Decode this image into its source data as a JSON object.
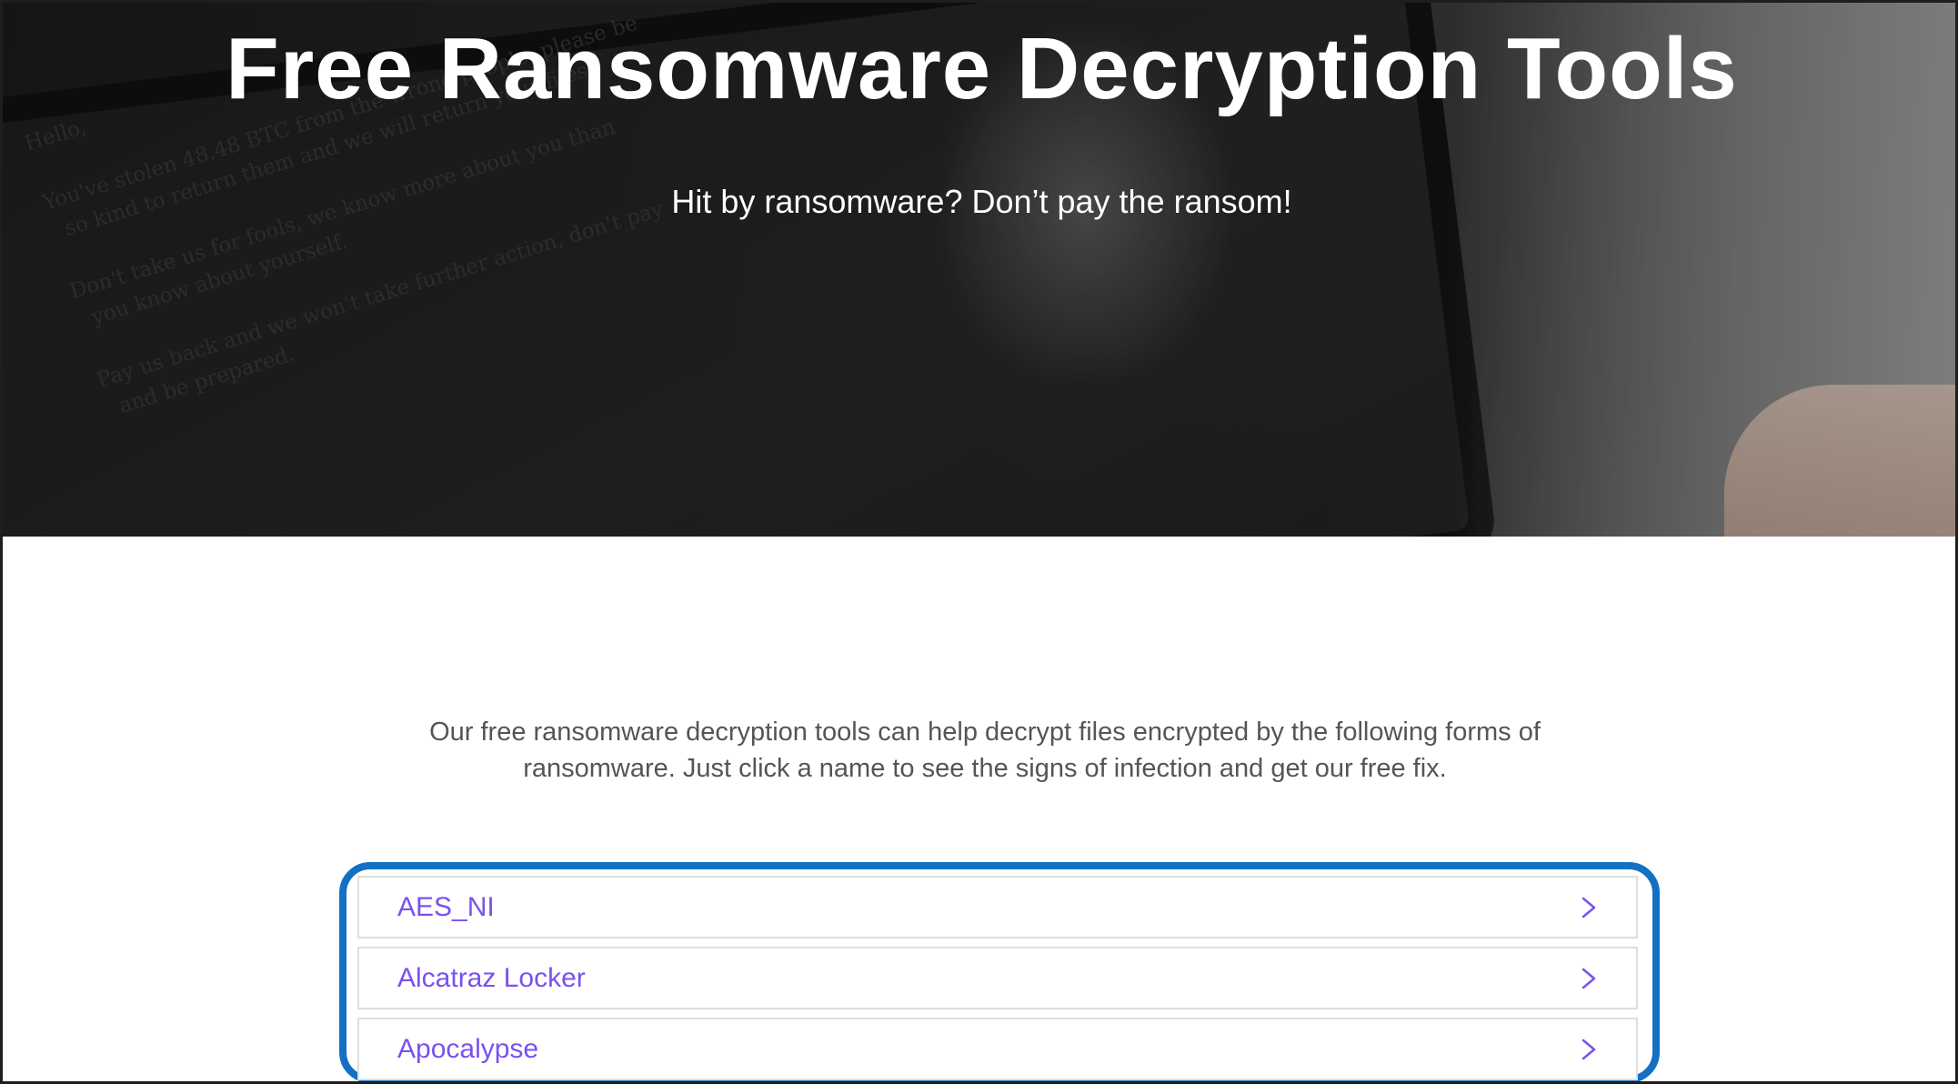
{
  "hero": {
    "title": "Free Ransomware Decryption Tools",
    "subtitle": "Hit by ransomware? Don’t pay the ransom!"
  },
  "intro": {
    "line1": "Our free ransomware decryption tools can help decrypt files encrypted by the following forms of",
    "line2": "ransomware. Just click a name to see the signs of infection and get our free fix."
  },
  "tools": [
    {
      "label": "AES_NI",
      "icon": "chevron-right-icon"
    },
    {
      "label": "Alcatraz Locker",
      "icon": "chevron-right-icon"
    },
    {
      "label": "Apocalypse",
      "icon": "chevron-right-icon"
    }
  ],
  "colors": {
    "link": "#7b50f0",
    "highlight_border": "#1470c4",
    "intro_text": "#555555",
    "hero_text": "#ffffff"
  }
}
